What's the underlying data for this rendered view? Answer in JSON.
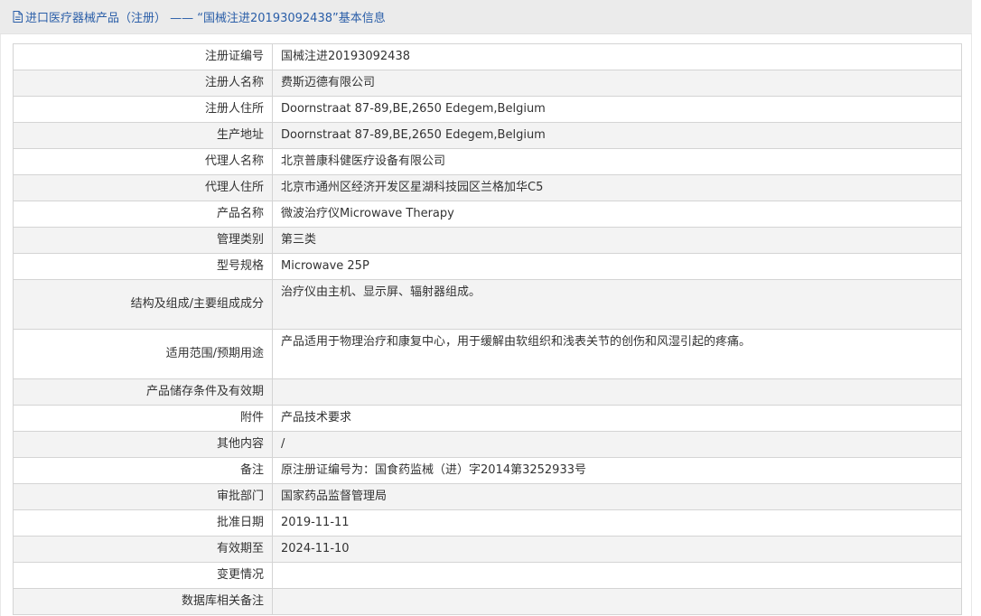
{
  "header": {
    "title": "进口医疗器械产品（注册） —— “国械注进20193092438”基本信息",
    "icon": "document-icon",
    "title_color": "#2a5ea8"
  },
  "rows": [
    {
      "label": "注册证编号",
      "value": "国械注进20193092438"
    },
    {
      "label": "注册人名称",
      "value": "费斯迈德有限公司"
    },
    {
      "label": "注册人住所",
      "value": "Doornstraat 87-89,BE,2650 Edegem,Belgium"
    },
    {
      "label": "生产地址",
      "value": "Doornstraat 87-89,BE,2650 Edegem,Belgium"
    },
    {
      "label": "代理人名称",
      "value": "北京普康科健医疗设备有限公司"
    },
    {
      "label": "代理人住所",
      "value": "北京市通州区经济开发区星湖科技园区兰格加华C5"
    },
    {
      "label": "产品名称",
      "value": "微波治疗仪Microwave Therapy"
    },
    {
      "label": "管理类别",
      "value": "第三类"
    },
    {
      "label": "型号规格",
      "value": "Microwave 25P"
    },
    {
      "label": "结构及组成/主要组成成分",
      "value": "治疗仪由主机、显示屏、辐射器组成。"
    },
    {
      "label": "适用范围/预期用途",
      "value": "产品适用于物理治疗和康复中心，用于缓解由软组织和浅表关节的创伤和风湿引起的疼痛。"
    },
    {
      "label": "产品储存条件及有效期",
      "value": ""
    },
    {
      "label": "附件",
      "value": "产品技术要求"
    },
    {
      "label": "其他内容",
      "value": "/"
    },
    {
      "label": "备注",
      "value": "原注册证编号为：国食药监械（进）字2014第3252933号"
    },
    {
      "label": "审批部门",
      "value": "国家药品监督管理局"
    },
    {
      "label": "批准日期",
      "value": "2019-11-11"
    },
    {
      "label": "有效期至",
      "value": "2024-11-10"
    },
    {
      "label": "变更情况",
      "value": ""
    },
    {
      "label": "数据库相关备注",
      "value": ""
    }
  ]
}
